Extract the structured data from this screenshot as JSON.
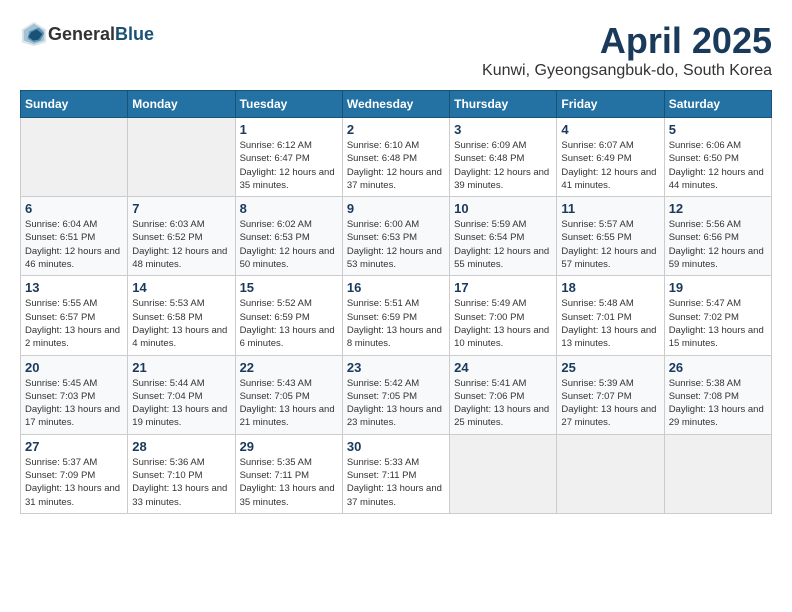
{
  "header": {
    "logo_general": "General",
    "logo_blue": "Blue",
    "month_title": "April 2025",
    "location": "Kunwi, Gyeongsangbuk-do, South Korea"
  },
  "weekdays": [
    "Sunday",
    "Monday",
    "Tuesday",
    "Wednesday",
    "Thursday",
    "Friday",
    "Saturday"
  ],
  "weeks": [
    [
      {
        "day": "",
        "sunrise": "",
        "sunset": "",
        "daylight": ""
      },
      {
        "day": "",
        "sunrise": "",
        "sunset": "",
        "daylight": ""
      },
      {
        "day": "1",
        "sunrise": "Sunrise: 6:12 AM",
        "sunset": "Sunset: 6:47 PM",
        "daylight": "Daylight: 12 hours and 35 minutes."
      },
      {
        "day": "2",
        "sunrise": "Sunrise: 6:10 AM",
        "sunset": "Sunset: 6:48 PM",
        "daylight": "Daylight: 12 hours and 37 minutes."
      },
      {
        "day": "3",
        "sunrise": "Sunrise: 6:09 AM",
        "sunset": "Sunset: 6:48 PM",
        "daylight": "Daylight: 12 hours and 39 minutes."
      },
      {
        "day": "4",
        "sunrise": "Sunrise: 6:07 AM",
        "sunset": "Sunset: 6:49 PM",
        "daylight": "Daylight: 12 hours and 41 minutes."
      },
      {
        "day": "5",
        "sunrise": "Sunrise: 6:06 AM",
        "sunset": "Sunset: 6:50 PM",
        "daylight": "Daylight: 12 hours and 44 minutes."
      }
    ],
    [
      {
        "day": "6",
        "sunrise": "Sunrise: 6:04 AM",
        "sunset": "Sunset: 6:51 PM",
        "daylight": "Daylight: 12 hours and 46 minutes."
      },
      {
        "day": "7",
        "sunrise": "Sunrise: 6:03 AM",
        "sunset": "Sunset: 6:52 PM",
        "daylight": "Daylight: 12 hours and 48 minutes."
      },
      {
        "day": "8",
        "sunrise": "Sunrise: 6:02 AM",
        "sunset": "Sunset: 6:53 PM",
        "daylight": "Daylight: 12 hours and 50 minutes."
      },
      {
        "day": "9",
        "sunrise": "Sunrise: 6:00 AM",
        "sunset": "Sunset: 6:53 PM",
        "daylight": "Daylight: 12 hours and 53 minutes."
      },
      {
        "day": "10",
        "sunrise": "Sunrise: 5:59 AM",
        "sunset": "Sunset: 6:54 PM",
        "daylight": "Daylight: 12 hours and 55 minutes."
      },
      {
        "day": "11",
        "sunrise": "Sunrise: 5:57 AM",
        "sunset": "Sunset: 6:55 PM",
        "daylight": "Daylight: 12 hours and 57 minutes."
      },
      {
        "day": "12",
        "sunrise": "Sunrise: 5:56 AM",
        "sunset": "Sunset: 6:56 PM",
        "daylight": "Daylight: 12 hours and 59 minutes."
      }
    ],
    [
      {
        "day": "13",
        "sunrise": "Sunrise: 5:55 AM",
        "sunset": "Sunset: 6:57 PM",
        "daylight": "Daylight: 13 hours and 2 minutes."
      },
      {
        "day": "14",
        "sunrise": "Sunrise: 5:53 AM",
        "sunset": "Sunset: 6:58 PM",
        "daylight": "Daylight: 13 hours and 4 minutes."
      },
      {
        "day": "15",
        "sunrise": "Sunrise: 5:52 AM",
        "sunset": "Sunset: 6:59 PM",
        "daylight": "Daylight: 13 hours and 6 minutes."
      },
      {
        "day": "16",
        "sunrise": "Sunrise: 5:51 AM",
        "sunset": "Sunset: 6:59 PM",
        "daylight": "Daylight: 13 hours and 8 minutes."
      },
      {
        "day": "17",
        "sunrise": "Sunrise: 5:49 AM",
        "sunset": "Sunset: 7:00 PM",
        "daylight": "Daylight: 13 hours and 10 minutes."
      },
      {
        "day": "18",
        "sunrise": "Sunrise: 5:48 AM",
        "sunset": "Sunset: 7:01 PM",
        "daylight": "Daylight: 13 hours and 13 minutes."
      },
      {
        "day": "19",
        "sunrise": "Sunrise: 5:47 AM",
        "sunset": "Sunset: 7:02 PM",
        "daylight": "Daylight: 13 hours and 15 minutes."
      }
    ],
    [
      {
        "day": "20",
        "sunrise": "Sunrise: 5:45 AM",
        "sunset": "Sunset: 7:03 PM",
        "daylight": "Daylight: 13 hours and 17 minutes."
      },
      {
        "day": "21",
        "sunrise": "Sunrise: 5:44 AM",
        "sunset": "Sunset: 7:04 PM",
        "daylight": "Daylight: 13 hours and 19 minutes."
      },
      {
        "day": "22",
        "sunrise": "Sunrise: 5:43 AM",
        "sunset": "Sunset: 7:05 PM",
        "daylight": "Daylight: 13 hours and 21 minutes."
      },
      {
        "day": "23",
        "sunrise": "Sunrise: 5:42 AM",
        "sunset": "Sunset: 7:05 PM",
        "daylight": "Daylight: 13 hours and 23 minutes."
      },
      {
        "day": "24",
        "sunrise": "Sunrise: 5:41 AM",
        "sunset": "Sunset: 7:06 PM",
        "daylight": "Daylight: 13 hours and 25 minutes."
      },
      {
        "day": "25",
        "sunrise": "Sunrise: 5:39 AM",
        "sunset": "Sunset: 7:07 PM",
        "daylight": "Daylight: 13 hours and 27 minutes."
      },
      {
        "day": "26",
        "sunrise": "Sunrise: 5:38 AM",
        "sunset": "Sunset: 7:08 PM",
        "daylight": "Daylight: 13 hours and 29 minutes."
      }
    ],
    [
      {
        "day": "27",
        "sunrise": "Sunrise: 5:37 AM",
        "sunset": "Sunset: 7:09 PM",
        "daylight": "Daylight: 13 hours and 31 minutes."
      },
      {
        "day": "28",
        "sunrise": "Sunrise: 5:36 AM",
        "sunset": "Sunset: 7:10 PM",
        "daylight": "Daylight: 13 hours and 33 minutes."
      },
      {
        "day": "29",
        "sunrise": "Sunrise: 5:35 AM",
        "sunset": "Sunset: 7:11 PM",
        "daylight": "Daylight: 13 hours and 35 minutes."
      },
      {
        "day": "30",
        "sunrise": "Sunrise: 5:33 AM",
        "sunset": "Sunset: 7:11 PM",
        "daylight": "Daylight: 13 hours and 37 minutes."
      },
      {
        "day": "",
        "sunrise": "",
        "sunset": "",
        "daylight": ""
      },
      {
        "day": "",
        "sunrise": "",
        "sunset": "",
        "daylight": ""
      },
      {
        "day": "",
        "sunrise": "",
        "sunset": "",
        "daylight": ""
      }
    ]
  ]
}
